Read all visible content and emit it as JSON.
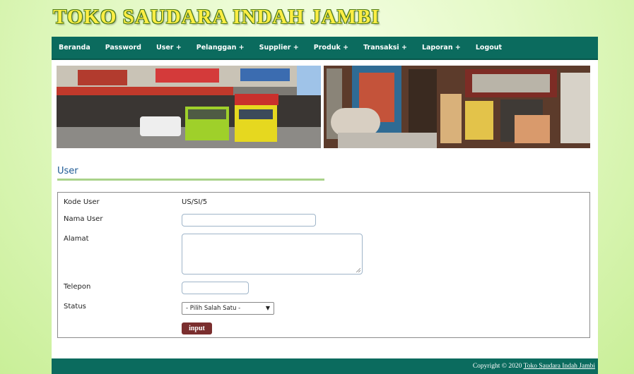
{
  "site": {
    "title": "TOKO SAUDARA INDAH JAMBI"
  },
  "nav": {
    "items": [
      "Beranda",
      "Password",
      "User +",
      "Pelanggan +",
      "Supplier +",
      "Produk +",
      "Transaksi +",
      "Laporan +",
      "Logout"
    ]
  },
  "section": {
    "title": "User"
  },
  "form": {
    "kode_label": "Kode User",
    "kode_value": "US/SI/5",
    "nama_label": "Nama User",
    "nama_value": "",
    "alamat_label": "Alamat",
    "alamat_value": "",
    "telepon_label": "Telepon",
    "telepon_value": "",
    "status_label": "Status",
    "status_selected": "- Pilih Salah Satu -",
    "submit_label": "input"
  },
  "footer": {
    "copyright_prefix": "Copyright © 2020",
    "link_text": "Toko Saudara Indah Jambi"
  },
  "colors": {
    "nav_bg": "#0b6b5e",
    "title_yellow": "#ffee44",
    "section_title": "#1e5a94",
    "submit_bg": "#7a2e2e"
  }
}
